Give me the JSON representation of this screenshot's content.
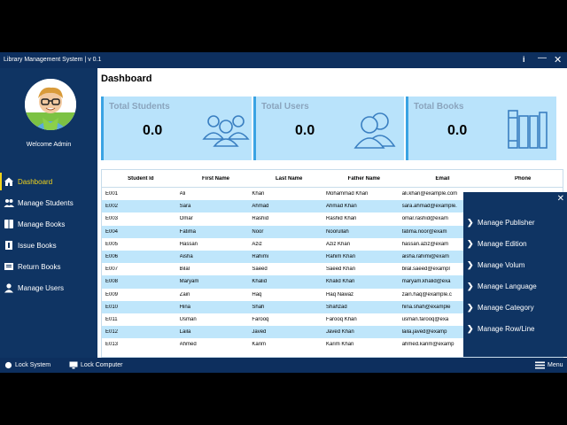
{
  "window": {
    "title": "Library Management System | v 0.1",
    "info_glyph": "i",
    "min_glyph": "—",
    "close_glyph": "✕"
  },
  "sidebar": {
    "welcome": "Welcome Admin",
    "items": [
      {
        "label": "Dashboard",
        "icon": "home-icon",
        "active": true
      },
      {
        "label": "Manage Students",
        "icon": "students-icon"
      },
      {
        "label": "Manage Books",
        "icon": "books-icon"
      },
      {
        "label": "Issue Books",
        "icon": "issue-books-icon"
      },
      {
        "label": "Return Books",
        "icon": "return-books-icon"
      },
      {
        "label": "Manage Users",
        "icon": "user-icon"
      }
    ]
  },
  "main": {
    "title": "Dashboard",
    "cards": [
      {
        "label": "Total Students",
        "value": "0.0",
        "icon": "students-group-icon"
      },
      {
        "label": "Total Users",
        "value": "0.0",
        "icon": "users-icon"
      },
      {
        "label": "Total Books",
        "value": "0.0",
        "icon": "books-shelf-icon"
      }
    ]
  },
  "table": {
    "headers": [
      "Student Id",
      "First Name",
      "Last Name",
      "Father Name",
      "Email",
      "Phone"
    ],
    "rows": [
      [
        "E001",
        "Ali",
        "Khan",
        "Mohammad Khan",
        "ali.khan@example.com",
        ""
      ],
      [
        "E002",
        "Sara",
        "Ahmad",
        "Ahmad Khan",
        "sara.ahmad@example.",
        ""
      ],
      [
        "E003",
        "Omar",
        "Rashid",
        "Rashid Khan",
        "omar.rashid@exam",
        ""
      ],
      [
        "E004",
        "Fatima",
        "Noor",
        "Noorullah",
        "fatima.noor@exam",
        ""
      ],
      [
        "E005",
        "Hassan",
        "Aziz",
        "Aziz Khan",
        "hassan.aziz@exam",
        ""
      ],
      [
        "E006",
        "Aisha",
        "Rahimi",
        "Rahim Khan",
        "aisha.rahimi@exam",
        ""
      ],
      [
        "E007",
        "Bilal",
        "Saeed",
        "Saeed Khan",
        "bilal.saeed@exampl",
        ""
      ],
      [
        "E008",
        "Maryam",
        "Khalid",
        "Khalid Khan",
        "maryam.khalid@exa",
        ""
      ],
      [
        "E009",
        "Zain",
        "Haq",
        "Haq Nawaz",
        "zain.haq@example.c",
        ""
      ],
      [
        "E010",
        "Hina",
        "Shah",
        "Shahzad",
        "hina.shah@example",
        ""
      ],
      [
        "E011",
        "Usman",
        "Farooq",
        "Farooq Khan",
        "usman.farooq@exa",
        ""
      ],
      [
        "E012",
        "Laila",
        "Javed",
        "Javed Khan",
        "laila.javed@examp",
        ""
      ],
      [
        "E013",
        "Ahmed",
        "Karim",
        "Karim Khan",
        "ahmed.karim@examp",
        ""
      ]
    ]
  },
  "flyout": {
    "close_glyph": "✕",
    "items": [
      "Manage Publisher",
      "Manage Edition",
      "Manage Volum",
      "Manage Language",
      "Manage Category",
      "Manage Row/Line"
    ]
  },
  "statusbar": {
    "lock_system": "Lock System",
    "lock_computer": "Lock Computer",
    "menu": "Menu"
  },
  "colors": {
    "navy": "#0f3463",
    "accent": "#f1d31a",
    "card_bg": "#b9e3fb",
    "row_alt": "#bfe6fb"
  }
}
